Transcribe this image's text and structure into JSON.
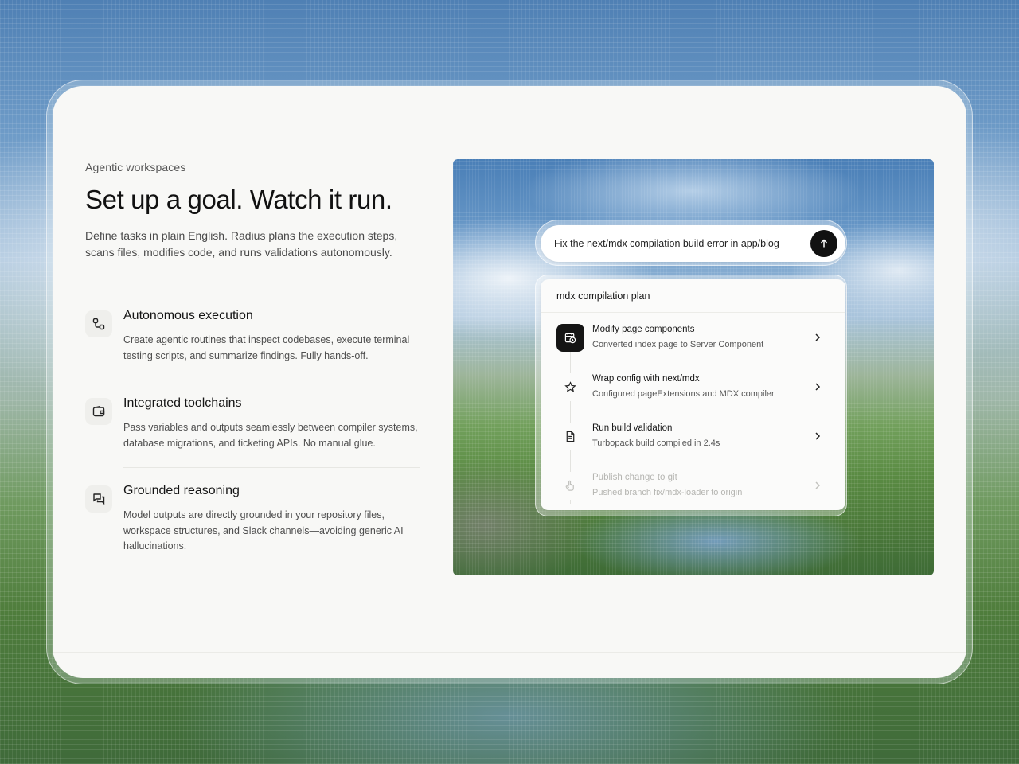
{
  "colors": {
    "card_background": "#f8f8f6",
    "heading": "#111111",
    "body_text": "#4a4a4a",
    "accent_dark": "#151515",
    "faded_text": "#b5b5b1"
  },
  "hero": {
    "eyebrow": "Agentic workspaces",
    "headline": "Set up a goal. Watch it run.",
    "intro": "Define tasks in plain English. Radius plans the execution steps, scans files, modifies code, and runs validations autonomously."
  },
  "features": [
    {
      "icon": "nodes-icon",
      "title": "Autonomous execution",
      "description": "Create agentic routines that inspect codebases, execute terminal testing scripts, and summarize findings. Fully hands-off."
    },
    {
      "icon": "wallet-icon",
      "title": "Integrated toolchains",
      "description": "Pass variables and outputs seamlessly between compiler systems, database migrations, and ticketing APIs. No manual glue."
    },
    {
      "icon": "chat-bubbles-icon",
      "title": "Grounded reasoning",
      "description": "Model outputs are directly grounded in your repository files, workspace structures, and Slack channels—avoiding generic AI hallucinations."
    }
  ],
  "prompt": {
    "text": "Fix the next/mdx compilation build error in app/blog",
    "send_icon": "arrow-up-icon"
  },
  "plan": {
    "title": "mdx compilation plan",
    "steps": [
      {
        "icon": "calendar-clock-icon",
        "title": "Modify page components",
        "subtitle": "Converted index page to Server Component",
        "state": "active"
      },
      {
        "icon": "star-icon",
        "title": "Wrap config with next/mdx",
        "subtitle": "Configured pageExtensions and MDX compiler",
        "state": "done"
      },
      {
        "icon": "document-icon",
        "title": "Run build validation",
        "subtitle": "Turbopack build compiled in 2.4s",
        "state": "done"
      },
      {
        "icon": "hand-pointer-icon",
        "title": "Publish change to git",
        "subtitle": "Pushed branch fix/mdx-loader to origin",
        "state": "pending"
      }
    ]
  }
}
